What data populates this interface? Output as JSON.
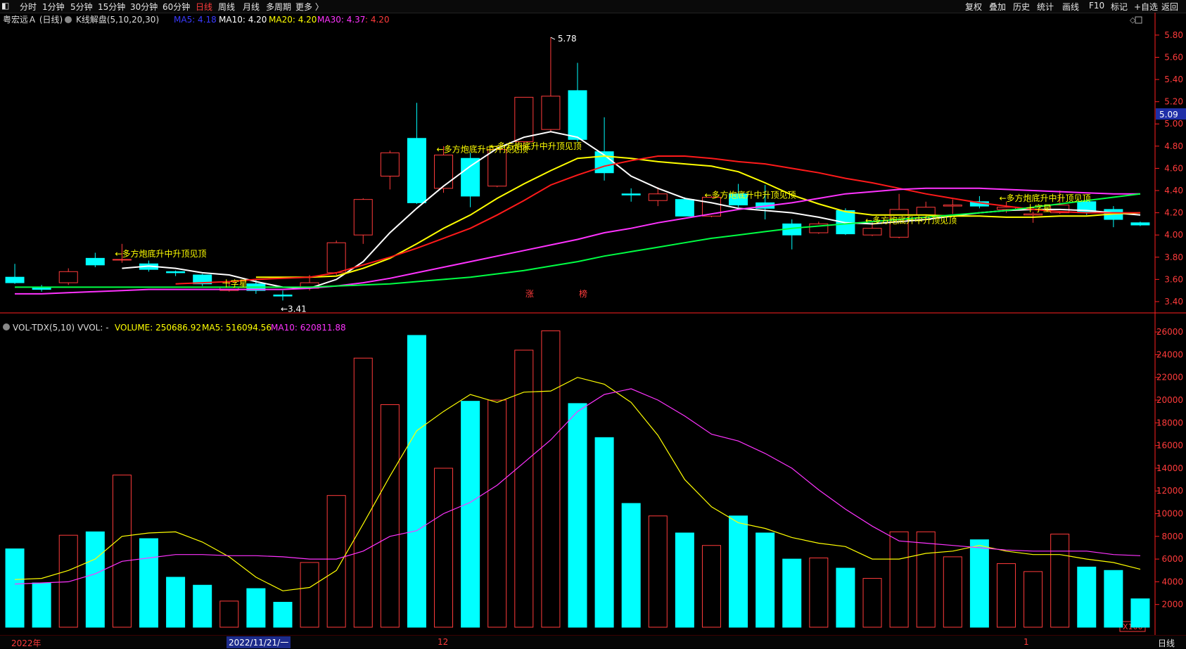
{
  "topbar": {
    "left_tabs": [
      "分时",
      "1分钟",
      "5分钟",
      "15分钟",
      "30分钟",
      "60分钟",
      "日线",
      "周线",
      "月线",
      "多周期",
      "更多 〉"
    ],
    "active_tab": "日线",
    "right_tabs": [
      "复权",
      "叠加",
      "历史",
      "统计",
      "画线",
      "F10",
      "标记",
      "+自选",
      "返回"
    ]
  },
  "main_panel": {
    "stock_title": "粤宏远Ａ (日线)",
    "indicator_name": "K线解盘(5,10,20,30)",
    "ma_readouts": [
      {
        "label": "MA5: 4.18",
        "color": "#3a3aff"
      },
      {
        "label": "MA10: 4.20",
        "color": "#ffffff"
      },
      {
        "label": "MA20: 4.20",
        "color": "#ffff00"
      },
      {
        "label": "MA30: 4.37",
        "color": "#ff33ff"
      },
      {
        "label": ": 4.20",
        "color": "#ff3b3b"
      }
    ],
    "current_price_tag": "5.09",
    "high_label": "5.78",
    "low_label": "←3.41",
    "board_markers": [
      "涨",
      "榜"
    ],
    "annotations": [
      {
        "text": "←多方炮底升中升顶见顶",
        "color": "#ffff00"
      },
      {
        "text": "←多方炮底升中升顶见顶",
        "color": "#ffff00"
      },
      {
        "text": "←多方炮底升中升顶见顶",
        "color": "#ffff00"
      },
      {
        "text": "←多方炮底升中升顶见顶",
        "color": "#ffff00"
      },
      {
        "text": "←多方炮底升中升顶见顶",
        "color": "#ffff00"
      },
      {
        "text": "←多方炮底升中升顶见顶",
        "color": "#ffff00"
      },
      {
        "text": "十字星",
        "color": "#ffff00"
      },
      {
        "text": "十字星",
        "color": "#ffff00"
      }
    ]
  },
  "vol_panel": {
    "indicator_name": "VOL-TDX(5,10)",
    "vvol_label": "VVOL: -",
    "readouts": [
      {
        "label": "VOLUME: 250686.92",
        "color": "#ffff00"
      },
      {
        "label": "MA5: 516094.56",
        "color": "#ffff00"
      },
      {
        "label": "MA10: 620811.88",
        "color": "#ff33ff"
      }
    ],
    "unit_label": "X100"
  },
  "bottombar": {
    "dates": [
      "2022年",
      "2022/11/21/一",
      "12",
      "1"
    ],
    "period_label": "日线"
  },
  "colors": {
    "up": "#ff3b3b",
    "down": "#00ffff",
    "axis": "#ff2020",
    "grid": "#3a0000",
    "ma5": "#ffffff",
    "ma10": "#ffff00",
    "ma20": "#ff1a1a",
    "ma30": "#ff33ff",
    "ma60": "#00ff44"
  },
  "chart_data": {
    "type": "candlestick",
    "price_axis": {
      "ticks": [
        "5.80",
        "5.60",
        "5.40",
        "5.20",
        "5.00",
        "4.80",
        "4.60",
        "4.40",
        "4.20",
        "4.00",
        "3.80",
        "3.60",
        "3.40"
      ],
      "ylim": [
        3.33,
        5.85
      ]
    },
    "volume_axis": {
      "ticks": [
        "26000",
        "24000",
        "22000",
        "20000",
        "18000",
        "16000",
        "14000",
        "12000",
        "10000",
        "8000",
        "6000",
        "4000",
        "2000"
      ],
      "ylim": [
        0,
        27000
      ]
    },
    "candles": [
      {
        "o": 3.62,
        "c": 3.57,
        "h": 3.74,
        "l": 3.56
      },
      {
        "o": 3.53,
        "c": 3.51,
        "h": 3.55,
        "l": 3.49
      },
      {
        "o": 3.57,
        "c": 3.67,
        "h": 3.7,
        "l": 3.55
      },
      {
        "o": 3.79,
        "c": 3.73,
        "h": 3.84,
        "l": 3.71
      },
      {
        "o": 3.78,
        "c": 3.78,
        "h": 3.92,
        "l": 3.75
      },
      {
        "o": 3.74,
        "c": 3.69,
        "h": 3.77,
        "l": 3.67
      },
      {
        "o": 3.67,
        "c": 3.66,
        "h": 3.68,
        "l": 3.63
      },
      {
        "o": 3.64,
        "c": 3.56,
        "h": 3.65,
        "l": 3.54
      },
      {
        "o": 3.5,
        "c": 3.53,
        "h": 3.58,
        "l": 3.49
      },
      {
        "o": 3.56,
        "c": 3.5,
        "h": 3.6,
        "l": 3.47
      },
      {
        "o": 3.46,
        "c": 3.45,
        "h": 3.5,
        "l": 3.41
      },
      {
        "o": 3.52,
        "c": 3.57,
        "h": 3.64,
        "l": 3.5
      },
      {
        "o": 3.66,
        "c": 3.93,
        "h": 3.95,
        "l": 3.64
      },
      {
        "o": 4.0,
        "c": 4.32,
        "h": 4.33,
        "l": 3.92
      },
      {
        "o": 4.53,
        "c": 4.74,
        "h": 4.76,
        "l": 4.41
      },
      {
        "o": 4.87,
        "c": 4.29,
        "h": 5.19,
        "l": 4.28
      },
      {
        "o": 4.42,
        "c": 4.72,
        "h": 4.8,
        "l": 4.38
      },
      {
        "o": 4.69,
        "c": 4.35,
        "h": 4.74,
        "l": 4.25
      },
      {
        "o": 4.44,
        "c": 4.77,
        "h": 4.8,
        "l": 4.43
      },
      {
        "o": 4.84,
        "c": 5.24,
        "h": 5.24,
        "l": 4.8
      },
      {
        "o": 4.95,
        "c": 5.25,
        "h": 5.78,
        "l": 4.93
      },
      {
        "o": 5.3,
        "c": 4.86,
        "h": 5.55,
        "l": 4.84
      },
      {
        "o": 4.75,
        "c": 4.56,
        "h": 5.06,
        "l": 4.49
      },
      {
        "o": 4.37,
        "c": 4.36,
        "h": 4.42,
        "l": 4.3
      },
      {
        "o": 4.31,
        "c": 4.37,
        "h": 4.43,
        "l": 4.26
      },
      {
        "o": 4.32,
        "c": 4.17,
        "h": 4.34,
        "l": 4.17
      },
      {
        "o": 4.17,
        "c": 4.34,
        "h": 4.35,
        "l": 4.16
      },
      {
        "o": 4.37,
        "c": 4.27,
        "h": 4.46,
        "l": 4.25
      },
      {
        "o": 4.29,
        "c": 4.24,
        "h": 4.45,
        "l": 4.14
      },
      {
        "o": 4.1,
        "c": 4.0,
        "h": 4.14,
        "l": 3.87
      },
      {
        "o": 4.02,
        "c": 4.1,
        "h": 4.12,
        "l": 4.01
      },
      {
        "o": 4.22,
        "c": 4.01,
        "h": 4.24,
        "l": 4.0
      },
      {
        "o": 4.0,
        "c": 4.06,
        "h": 4.12,
        "l": 3.99
      },
      {
        "o": 3.98,
        "c": 4.23,
        "h": 4.37,
        "l": 3.97
      },
      {
        "o": 4.18,
        "c": 4.25,
        "h": 4.3,
        "l": 4.13
      },
      {
        "o": 4.26,
        "c": 4.27,
        "h": 4.32,
        "l": 4.19
      },
      {
        "o": 4.3,
        "c": 4.26,
        "h": 4.35,
        "l": 4.24
      },
      {
        "o": 4.23,
        "c": 4.25,
        "h": 4.3,
        "l": 4.2
      },
      {
        "o": 4.18,
        "c": 4.19,
        "h": 4.21,
        "l": 4.11
      },
      {
        "o": 4.2,
        "c": 4.27,
        "h": 4.4,
        "l": 4.19
      },
      {
        "o": 4.3,
        "c": 4.2,
        "h": 4.32,
        "l": 4.18
      },
      {
        "o": 4.23,
        "c": 4.14,
        "h": 4.26,
        "l": 4.07
      },
      {
        "o": 4.11,
        "c": 4.09,
        "h": 4.12,
        "l": 4.08
      }
    ],
    "ma_series": [
      {
        "key": "ma5",
        "values": [
          null,
          null,
          null,
          null,
          3.7,
          3.72,
          3.7,
          3.66,
          3.64,
          3.58,
          3.53,
          3.52,
          3.6,
          3.76,
          4.02,
          4.24,
          4.44,
          4.62,
          4.78,
          4.88,
          4.93,
          4.88,
          4.72,
          4.53,
          4.42,
          4.33,
          4.29,
          4.24,
          4.22,
          4.2,
          4.16,
          4.11,
          4.1,
          4.12,
          4.14,
          4.17,
          4.2,
          4.22,
          4.23,
          4.23,
          4.22,
          4.2,
          4.18
        ]
      },
      {
        "key": "ma10",
        "values": [
          null,
          null,
          null,
          null,
          null,
          null,
          null,
          null,
          null,
          3.62,
          3.62,
          3.62,
          3.63,
          3.7,
          3.79,
          3.92,
          4.06,
          4.18,
          4.33,
          4.46,
          4.58,
          4.69,
          4.71,
          4.69,
          4.66,
          4.64,
          4.62,
          4.57,
          4.47,
          4.36,
          4.28,
          4.21,
          4.18,
          4.18,
          4.18,
          4.17,
          4.17,
          4.16,
          4.16,
          4.17,
          4.17,
          4.19,
          4.2
        ]
      },
      {
        "key": "ma20",
        "values": [
          null,
          null,
          null,
          null,
          null,
          null,
          3.56,
          3.57,
          3.58,
          3.6,
          3.61,
          3.62,
          3.66,
          3.73,
          3.8,
          3.88,
          3.97,
          4.06,
          4.18,
          4.31,
          4.45,
          4.54,
          4.62,
          4.67,
          4.71,
          4.71,
          4.69,
          4.66,
          4.64,
          4.6,
          4.56,
          4.51,
          4.47,
          4.42,
          4.37,
          4.33,
          4.29,
          4.26,
          4.23,
          4.21,
          4.2,
          4.2,
          4.2
        ]
      },
      {
        "key": "ma30",
        "values": [
          3.47,
          3.47,
          3.48,
          3.49,
          3.5,
          3.51,
          3.51,
          3.51,
          3.51,
          3.51,
          3.51,
          3.52,
          3.54,
          3.57,
          3.61,
          3.66,
          3.71,
          3.76,
          3.81,
          3.86,
          3.91,
          3.96,
          4.02,
          4.06,
          4.11,
          4.15,
          4.19,
          4.23,
          4.26,
          4.29,
          4.33,
          4.37,
          4.39,
          4.41,
          4.42,
          4.42,
          4.42,
          4.41,
          4.4,
          4.39,
          4.38,
          4.37,
          4.37
        ]
      },
      {
        "key": "ma60",
        "values": [
          3.53,
          3.53,
          3.53,
          3.53,
          3.53,
          3.53,
          3.53,
          3.53,
          3.53,
          3.53,
          3.53,
          3.53,
          3.54,
          3.55,
          3.56,
          3.58,
          3.6,
          3.62,
          3.65,
          3.68,
          3.72,
          3.76,
          3.81,
          3.85,
          3.89,
          3.93,
          3.97,
          4.0,
          4.03,
          4.06,
          4.08,
          4.1,
          4.12,
          4.14,
          4.16,
          4.18,
          4.2,
          4.22,
          4.25,
          4.28,
          4.31,
          4.34,
          4.37
        ]
      }
    ],
    "volume": [
      6900,
      3900,
      8100,
      8400,
      13400,
      7800,
      4400,
      3700,
      2300,
      3400,
      2200,
      5700,
      11600,
      23700,
      19600,
      25700,
      14000,
      19900,
      20000,
      24400,
      26100,
      19700,
      16700,
      10900,
      9800,
      8300,
      7200,
      9800,
      8300,
      6000,
      6100,
      5200,
      4300,
      8400,
      8400,
      6200,
      7700,
      5600,
      4900,
      8200,
      5300,
      5000,
      2500
    ],
    "vol_ma5": [
      4200,
      4300,
      5000,
      6000,
      8000,
      8300,
      8400,
      7500,
      6200,
      4400,
      3200,
      3500,
      5000,
      9100,
      13300,
      17300,
      19000,
      20500,
      19800,
      20700,
      20800,
      22000,
      21400,
      19800,
      16900,
      13000,
      10600,
      9200,
      8700,
      7900,
      7400,
      7100,
      6000,
      6000,
      6500,
      6700,
      7200,
      6700,
      6400,
      6400,
      6000,
      5700,
      5100
    ],
    "vol_ma10": [
      3800,
      3900,
      4000,
      4700,
      5800,
      6100,
      6400,
      6400,
      6300,
      6300,
      6200,
      6000,
      6000,
      6700,
      8000,
      8500,
      10000,
      11000,
      12500,
      14500,
      16500,
      19000,
      20500,
      21000,
      20000,
      18600,
      17000,
      16400,
      15300,
      14000,
      12100,
      10400,
      8900,
      7600,
      7400,
      7200,
      7000,
      6800,
      6700,
      6700,
      6700,
      6400,
      6300
    ]
  }
}
